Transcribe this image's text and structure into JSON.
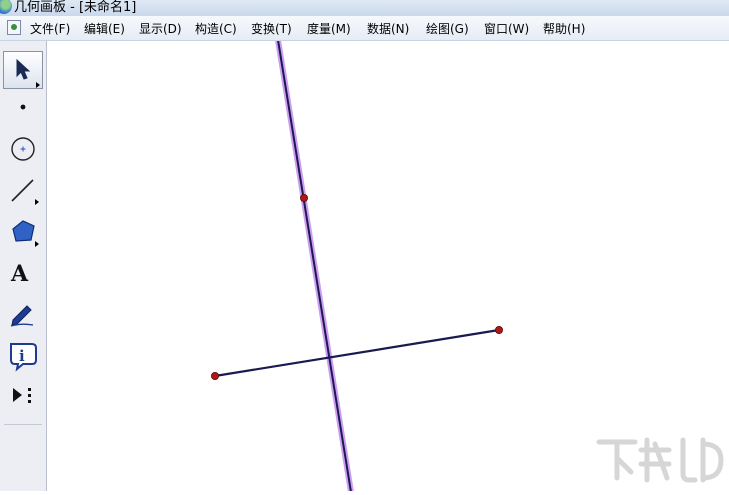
{
  "window": {
    "title": "几何画板 - [未命名1]"
  },
  "menu": {
    "items": [
      "文件(F)",
      "编辑(E)",
      "显示(D)",
      "构造(C)",
      "变换(T)",
      "度量(M)",
      "数据(N)",
      "绘图(G)",
      "窗口(W)",
      "帮助(H)"
    ]
  },
  "toolbox": {
    "tools": [
      {
        "name": "arrow-tool",
        "selected": true
      },
      {
        "name": "point-tool"
      },
      {
        "name": "compass-tool"
      },
      {
        "name": "straightedge-tool"
      },
      {
        "name": "polygon-tool"
      },
      {
        "name": "text-tool",
        "glyph": "A"
      },
      {
        "name": "marker-tool"
      },
      {
        "name": "information-tool",
        "glyph": "i"
      },
      {
        "name": "custom-tool"
      }
    ]
  },
  "canvas": {
    "objects": [
      {
        "type": "line",
        "color": "#1a1a50",
        "highlight": "#c58cf0",
        "selected": true
      },
      {
        "type": "segment",
        "color": "#1a1a50"
      },
      {
        "type": "point",
        "color": "#b01818"
      },
      {
        "type": "point",
        "color": "#b01818"
      },
      {
        "type": "point",
        "color": "#b01818"
      }
    ]
  },
  "colors": {
    "point": "#b01818",
    "line": "#1a1a50",
    "selection_highlight": "#c58cf0",
    "titlebar": "#c9d8ec",
    "toolbox": "#eceef3"
  }
}
